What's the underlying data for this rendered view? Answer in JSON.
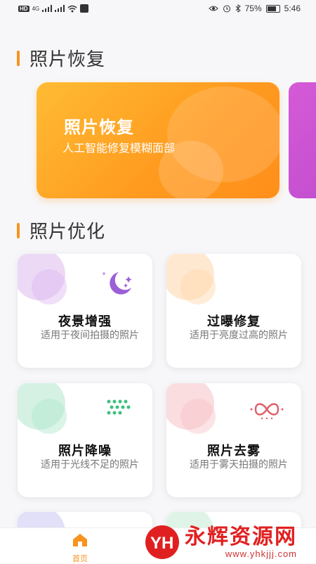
{
  "status": {
    "battery": "75%",
    "time": "5:46",
    "hd": "HD",
    "network": "4G"
  },
  "sections": {
    "recovery_title": "照片恢复",
    "optimize_title": "照片优化"
  },
  "hero": {
    "title": "照片恢复",
    "subtitle": "人工智能修复模糊面部",
    "color": "#ff9f1f"
  },
  "cards": [
    {
      "title": "夜景增强",
      "desc": "适用于夜间拍摄的照片",
      "icon": "moon-stars-icon"
    },
    {
      "title": "过曝修复",
      "desc": "适用于亮度过高的照片",
      "icon": ""
    },
    {
      "title": "照片降噪",
      "desc": "适用于光线不足的照片",
      "icon": "dots-grid-icon"
    },
    {
      "title": "照片去雾",
      "desc": "适用于雾天拍摄的照片",
      "icon": "infinity-dots-icon"
    }
  ],
  "tabbar": {
    "home_label": "首页",
    "accent": "#f7931e"
  },
  "watermark": {
    "name": "永辉资源网",
    "url": "www.yhkjjj.com"
  }
}
